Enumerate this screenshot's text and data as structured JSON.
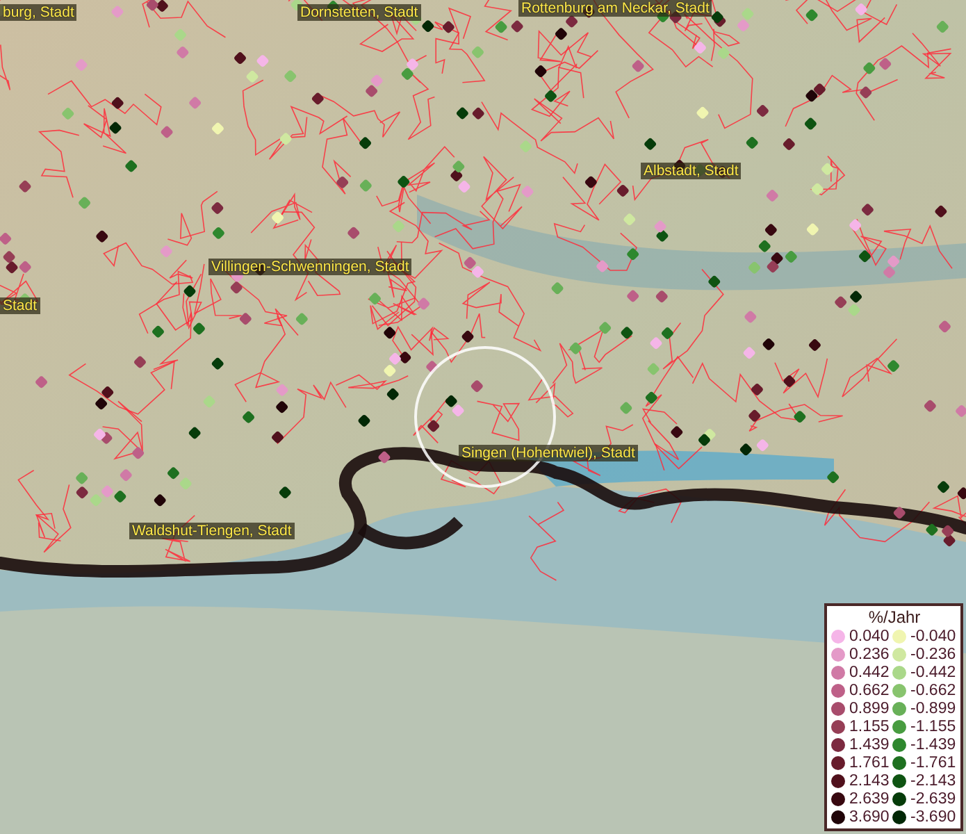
{
  "map_labels": [
    {
      "text": "burg, Stadt"
    },
    {
      "text": "Dornstetten, Stadt"
    },
    {
      "text": "Rottenburg am Neckar, Stadt"
    },
    {
      "text": "Albstadt, Stadt"
    },
    {
      "text": "Villingen-Schwenningen, Stadt"
    },
    {
      "text": "Stadt"
    },
    {
      "text": "Singen (Hohentwiel), Stadt"
    },
    {
      "text": "Waldshut-Tiengen, Stadt"
    }
  ],
  "legend": {
    "title": "%/Jahr",
    "rows": [
      {
        "left": {
          "value": "0.040",
          "color": "#f5b5e8"
        },
        "right": {
          "value": "-0.040",
          "color": "#f0f5b0"
        }
      },
      {
        "left": {
          "value": "0.236",
          "color": "#e49ac8"
        },
        "right": {
          "value": "-0.236",
          "color": "#cfe8a0"
        }
      },
      {
        "left": {
          "value": "0.442",
          "color": "#d07aa6"
        },
        "right": {
          "value": "-0.442",
          "color": "#aad88a"
        }
      },
      {
        "left": {
          "value": "0.662",
          "color": "#be6088"
        },
        "right": {
          "value": "-0.662",
          "color": "#88c46e"
        }
      },
      {
        "left": {
          "value": "0.899",
          "color": "#a84c6c"
        },
        "right": {
          "value": "-0.899",
          "color": "#68b058"
        }
      },
      {
        "left": {
          "value": "1.155",
          "color": "#963e56"
        },
        "right": {
          "value": "-1.155",
          "color": "#489c40"
        }
      },
      {
        "left": {
          "value": "1.439",
          "color": "#7c2a40"
        },
        "right": {
          "value": "-1.439",
          "color": "#2e882e"
        }
      },
      {
        "left": {
          "value": "1.761",
          "color": "#681c2c"
        },
        "right": {
          "value": "-1.761",
          "color": "#1e7020"
        }
      },
      {
        "left": {
          "value": "2.143",
          "color": "#50101c"
        },
        "right": {
          "value": "-2.143",
          "color": "#0e5412"
        }
      },
      {
        "left": {
          "value": "2.639",
          "color": "#380810"
        },
        "right": {
          "value": "-2.639",
          "color": "#063c0a"
        }
      },
      {
        "left": {
          "value": "3.690",
          "color": "#200408"
        },
        "right": {
          "value": "-3.690",
          "color": "#022806"
        }
      }
    ]
  }
}
